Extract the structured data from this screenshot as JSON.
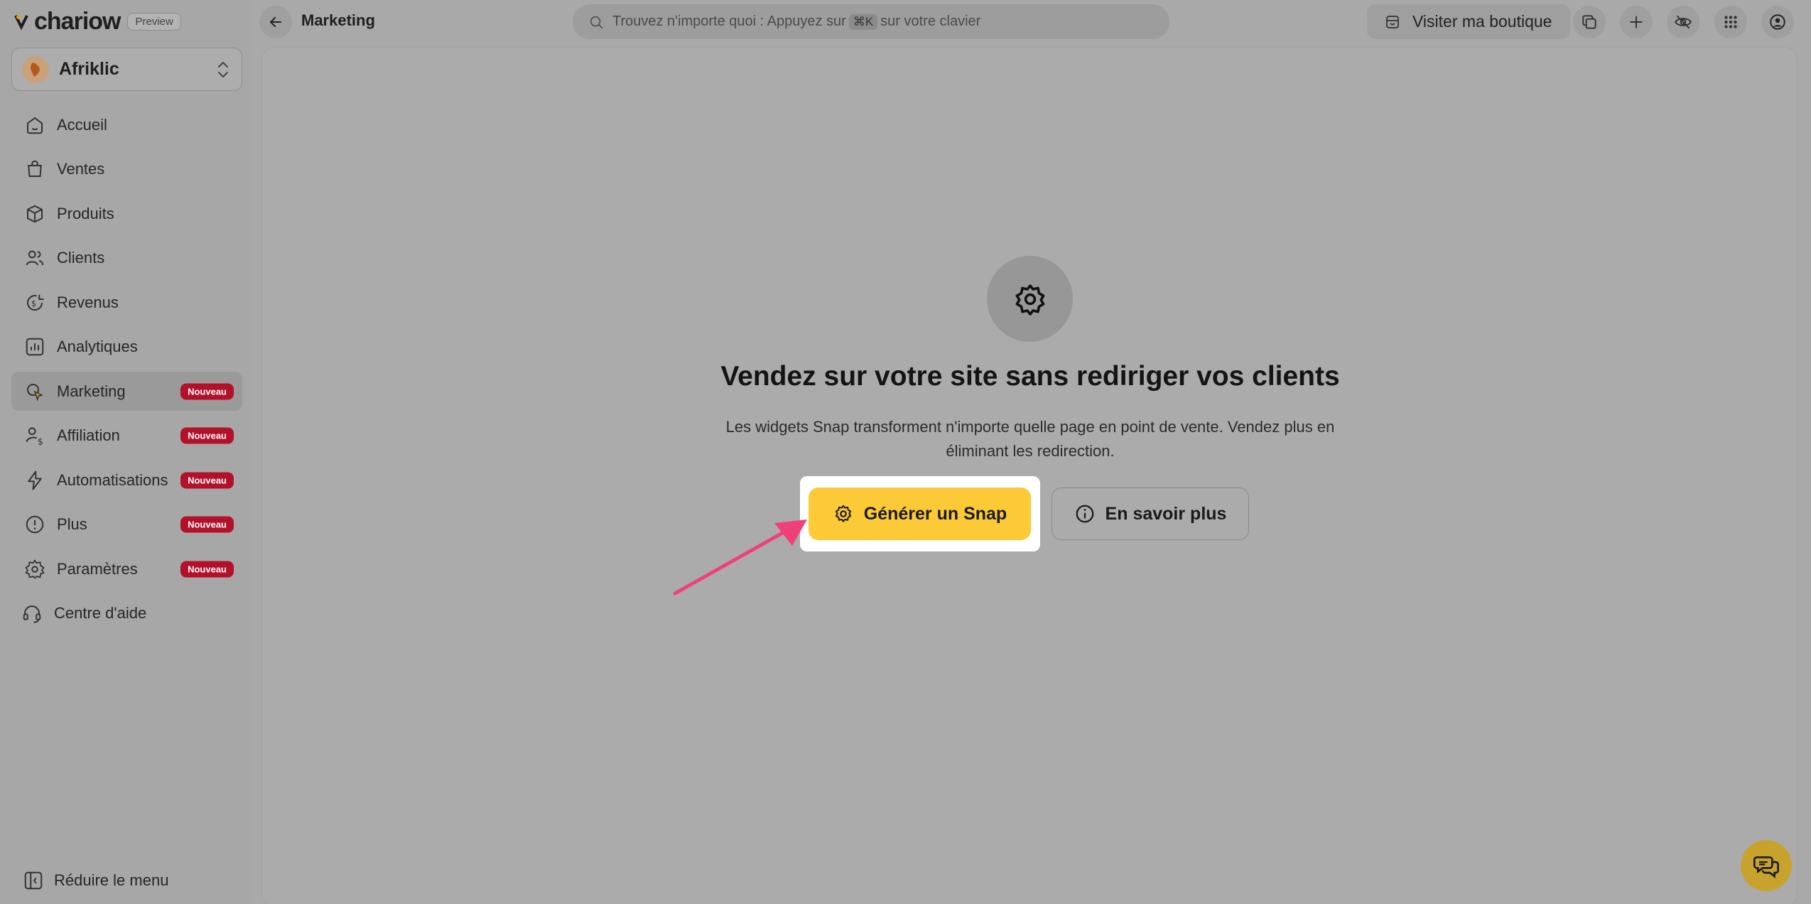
{
  "brand": {
    "name": "chariow",
    "preview_label": "Preview"
  },
  "store": {
    "name": "Afriklic",
    "avatar_icon": "afriklic-logo"
  },
  "nav": {
    "items": [
      {
        "label": "Accueil",
        "icon": "home-icon",
        "badge": ""
      },
      {
        "label": "Ventes",
        "icon": "shopping-bag-icon",
        "badge": ""
      },
      {
        "label": "Produits",
        "icon": "box-icon",
        "badge": ""
      },
      {
        "label": "Clients",
        "icon": "users-icon",
        "badge": ""
      },
      {
        "label": "Revenus",
        "icon": "revenue-icon",
        "badge": ""
      },
      {
        "label": "Analytiques",
        "icon": "chart-icon",
        "badge": ""
      },
      {
        "label": "Marketing",
        "icon": "marketing-icon",
        "badge": "Nouveau",
        "active": true
      },
      {
        "label": "Affiliation",
        "icon": "affiliate-icon",
        "badge": "Nouveau"
      },
      {
        "label": "Automatisations",
        "icon": "lightning-icon",
        "badge": "Nouveau"
      },
      {
        "label": "Plus",
        "icon": "more-icon",
        "badge": "Nouveau"
      },
      {
        "label": "Paramètres",
        "icon": "settings-icon",
        "badge": "Nouveau"
      },
      {
        "label": "Centre d'aide",
        "icon": "headset-icon",
        "badge": ""
      }
    ],
    "collapse_label": "Réduire le menu"
  },
  "topbar": {
    "page_title": "Marketing",
    "search_before": "Trouvez n'importe quoi : Appuyez sur",
    "search_kbd": "⌘K",
    "search_after": "sur votre clavier",
    "visit_label": "Visiter ma boutique"
  },
  "empty_state": {
    "headline": "Vendez sur votre site sans rediriger vos clients",
    "subtext": "Les widgets Snap transforment n'importe quelle page en point de vente. Vendez plus en éliminant les redirection.",
    "primary_label": "Générer un Snap",
    "secondary_label": "En savoir plus"
  },
  "colors": {
    "accent_yellow": "#fcca37",
    "badge_red": "#b3102a",
    "arrow_pink": "#f0407a"
  }
}
